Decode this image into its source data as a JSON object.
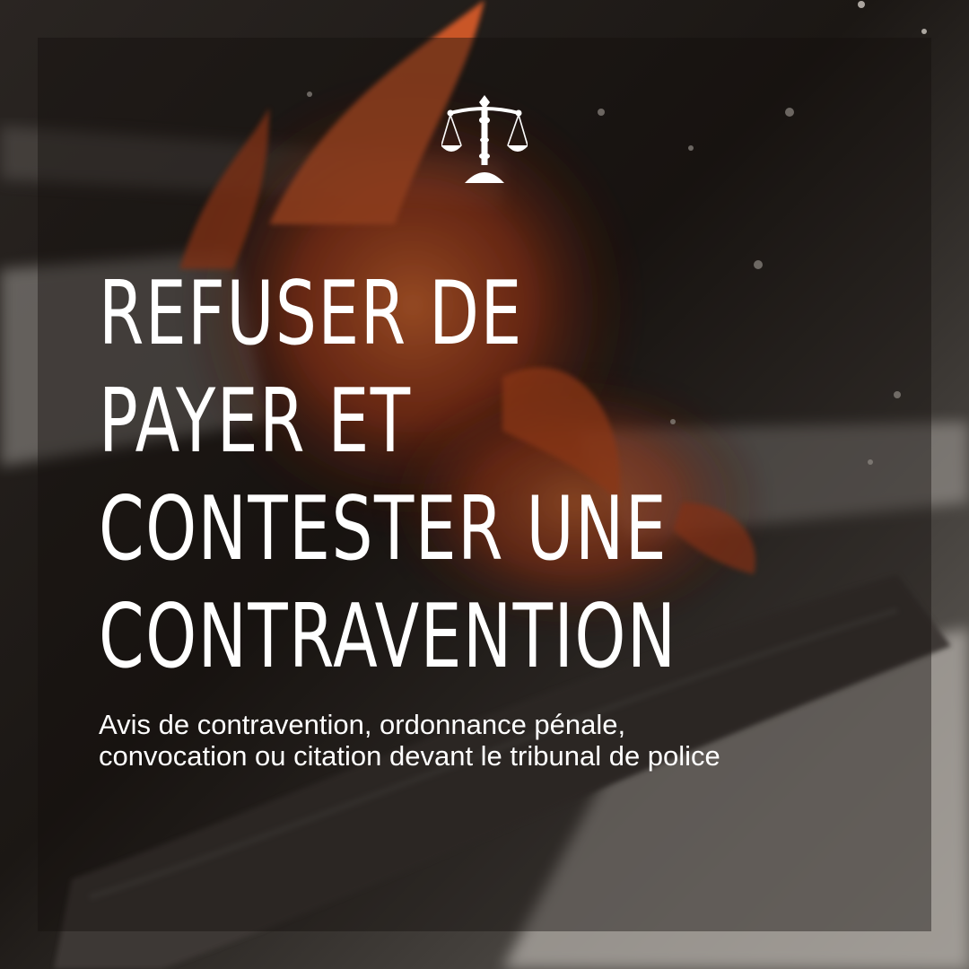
{
  "brand": {
    "logo_icon": "scales-of-justice-icon",
    "logo_color": "#ffffff"
  },
  "headline": {
    "lines": [
      "REFUSER DE",
      "PAYER ET",
      "CONTESTER UNE",
      "CONTRAVENTION"
    ]
  },
  "subtitle": {
    "lines": [
      "Avis de contravention, ordonnance pénale,",
      "convocation ou citation devant le tribunal de police"
    ]
  },
  "colors": {
    "text": "#ffffff",
    "flame_accent": "#e0521f",
    "background_dark": "#1a1613"
  }
}
